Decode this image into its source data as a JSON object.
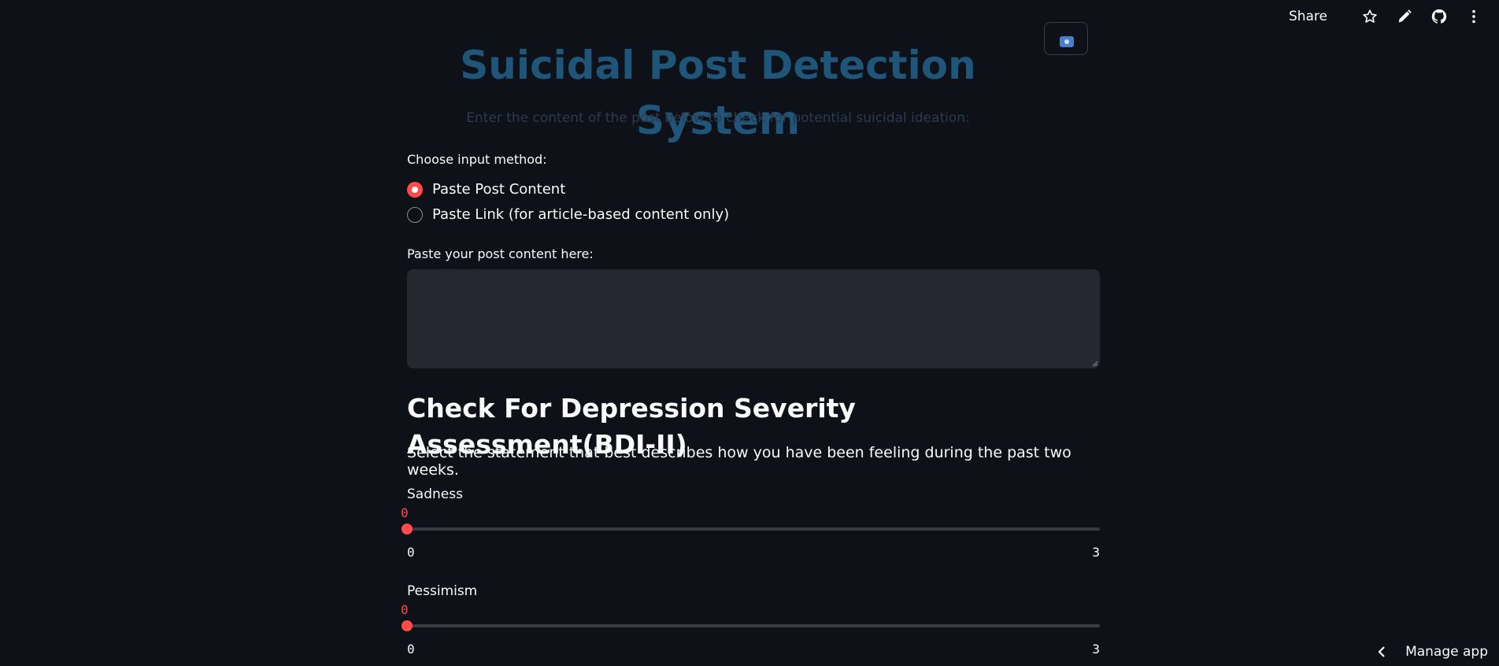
{
  "toolbar": {
    "share_label": "Share",
    "icons": [
      "star-icon",
      "pencil-icon",
      "github-icon",
      "more-vertical-icon"
    ]
  },
  "header": {
    "title": "Suicidal Post Detection System",
    "subtitle": "Enter the content of the post below to check for potential suicidal ideation:"
  },
  "input_method": {
    "label": "Choose input method:",
    "options": [
      {
        "label": "Paste Post Content",
        "selected": true
      },
      {
        "label": "Paste Link (for article-based content only)",
        "selected": false
      }
    ]
  },
  "post_input": {
    "label": "Paste your post content here:",
    "value": ""
  },
  "assessment": {
    "heading": "Check For Depression Severity Assessment(BDI-II)",
    "instructions": "Select the statement that best describes how you have been feeling during the past two weeks.",
    "sliders": [
      {
        "label": "Sadness",
        "value": "0",
        "min": "0",
        "max": "3",
        "fraction": 0
      },
      {
        "label": "Pessimism",
        "value": "0",
        "min": "0",
        "max": "3",
        "fraction": 0
      }
    ]
  },
  "footer": {
    "manage_label": "Manage app"
  },
  "colors": {
    "background": "#0e1117",
    "accent": "#ff4b4b",
    "title": "#1f5578",
    "input_bg": "#262730"
  }
}
